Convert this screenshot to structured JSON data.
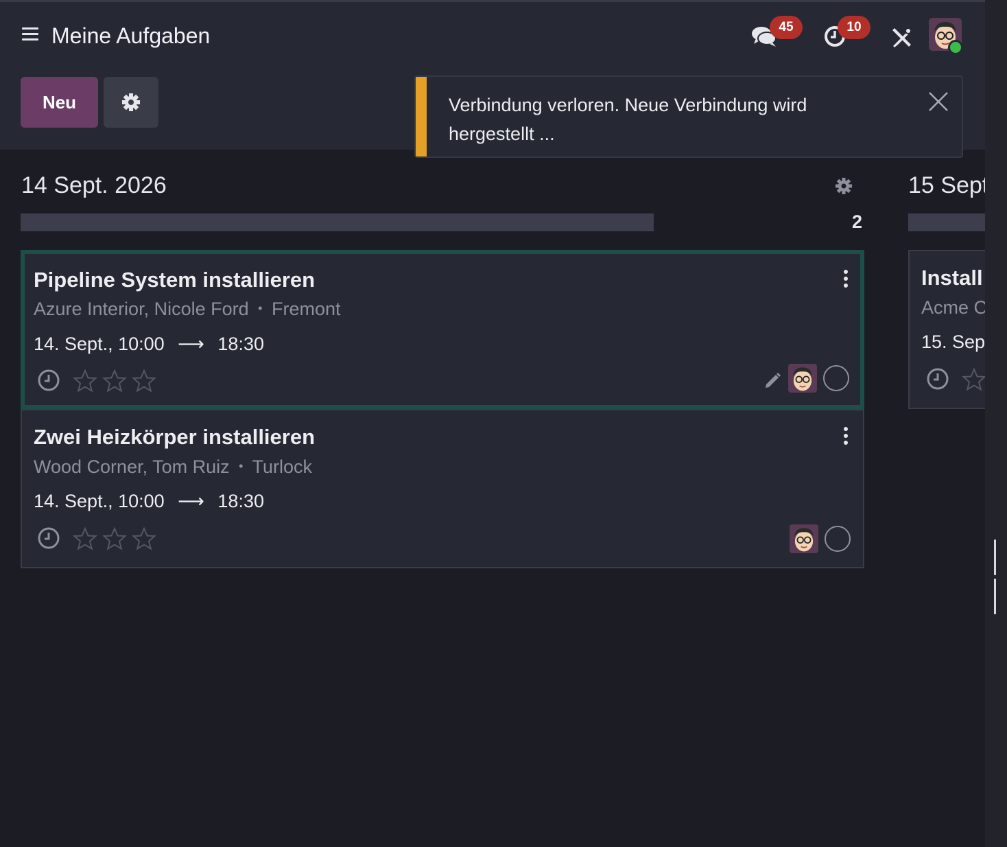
{
  "header": {
    "title": "Meine Aufgaben",
    "messages_badge": "45",
    "activities_badge": "10"
  },
  "toolbar": {
    "new_label": "Neu"
  },
  "toast": {
    "message": "Verbindung verloren. Neue Verbindung wird hergestellt ..."
  },
  "columns": [
    {
      "title": "14 Sept. 2026",
      "count": "2",
      "progress": 0.75,
      "cards": [
        {
          "title": "Pipeline System installieren",
          "customer": "Azure Interior, Nicole Ford",
          "separator": "•",
          "location": "Fremont",
          "start": "14. Sept., 10:00",
          "arrow": "⟶",
          "end": "18:30",
          "priority": 0,
          "selected": true
        },
        {
          "title": "Zwei Heizkörper installieren",
          "customer": "Wood Corner, Tom Ruiz",
          "separator": "•",
          "location": "Turlock",
          "start": "14. Sept., 10:00",
          "arrow": "⟶",
          "end": "18:30",
          "priority": 0,
          "selected": false
        }
      ]
    },
    {
      "title": "15 Sept",
      "cards": [
        {
          "title": "Install",
          "customer": "Acme C",
          "start": "15. Sep"
        }
      ]
    }
  ],
  "colors": {
    "accent": "#6b3c66",
    "warning": "#e3a127",
    "badge": "#b32f2a",
    "online": "#3dbb49",
    "selected_border": "#1f4d47"
  },
  "icons": [
    "menu-icon",
    "chat-icon",
    "clock-icon",
    "tools-icon",
    "gear-icon",
    "close-icon",
    "kebab-icon",
    "star-icon",
    "pencil-icon"
  ]
}
